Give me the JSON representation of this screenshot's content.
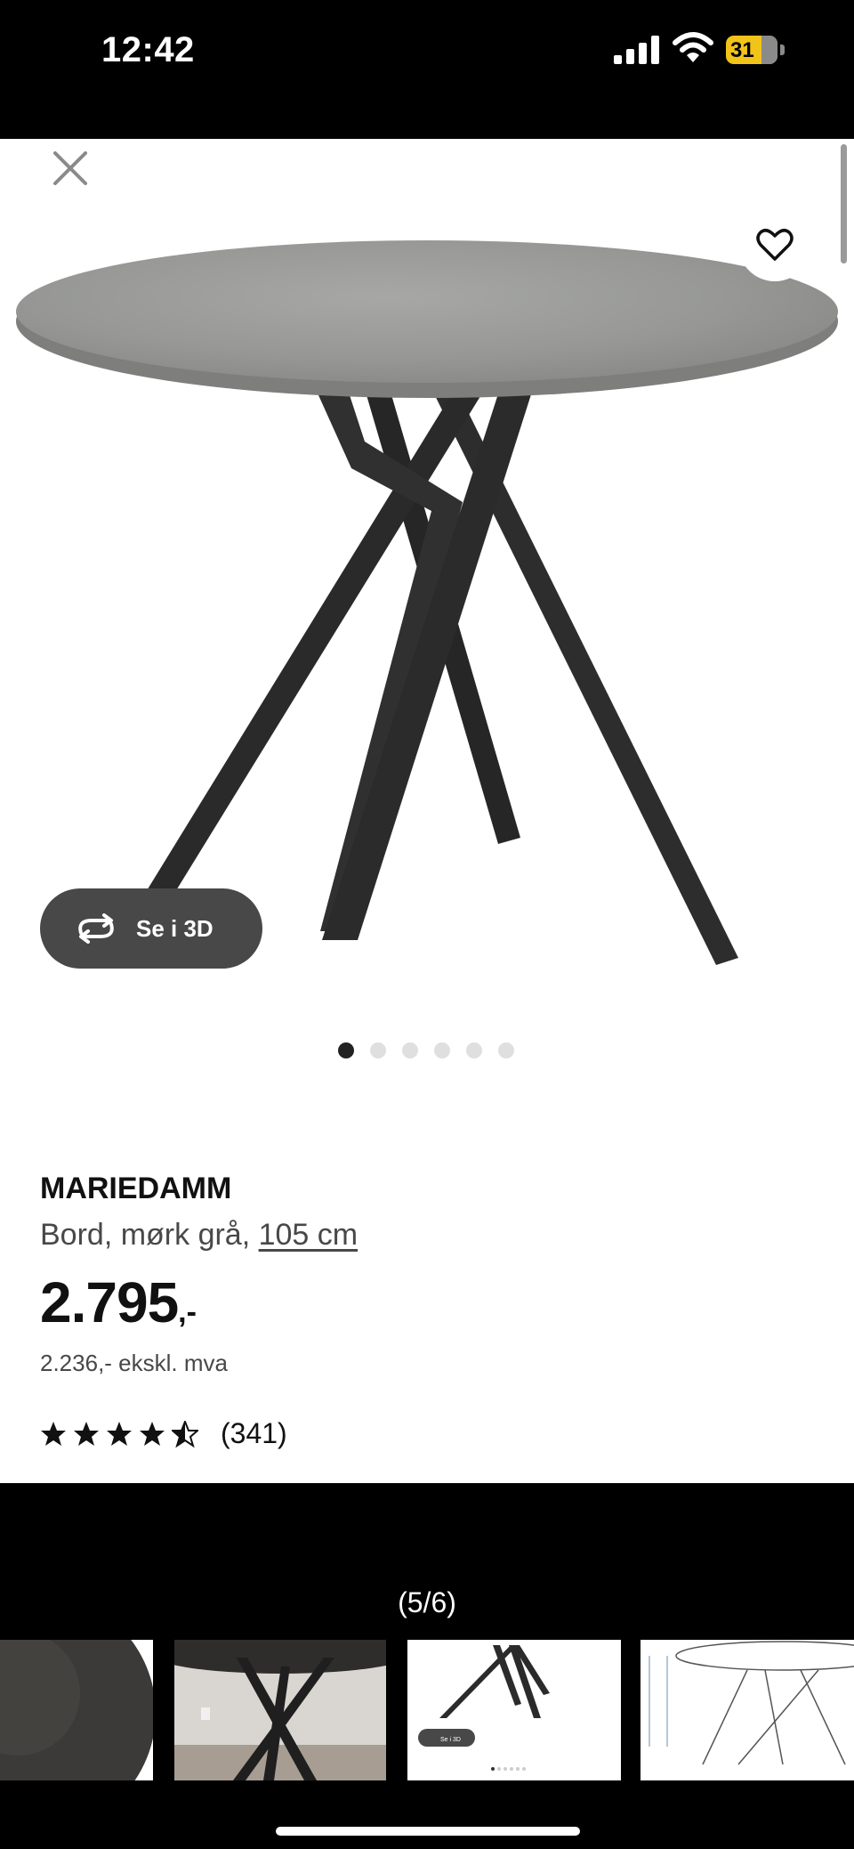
{
  "status_bar": {
    "time": "12:42",
    "battery": "31"
  },
  "product": {
    "name": "MARIEDAMM",
    "desc_prefix": "Bord, mørk grå, ",
    "size": "105 cm",
    "price": "2.795",
    "price_suffix": ",-",
    "price_ex_vat": "2.236,- ekskl. mva",
    "rating_stars": 4.5,
    "rating_count": "(341)"
  },
  "view_3d_label": "Se i 3D",
  "carousel": {
    "total": 6,
    "active_index": 0
  },
  "gallery": {
    "counter": "(5/6)",
    "thumb_3d_label": "Se i 3D"
  },
  "icons": {
    "close": "close-icon",
    "favorite": "heart-icon",
    "view_3d": "rotate-3d-icon",
    "signal": "cellular-signal-icon",
    "wifi": "wifi-icon",
    "battery": "battery-charging-icon"
  },
  "colors": {
    "battery": "#f2c318",
    "button_3d": "#484848",
    "text": "#111111",
    "secondary_text": "#484848"
  }
}
